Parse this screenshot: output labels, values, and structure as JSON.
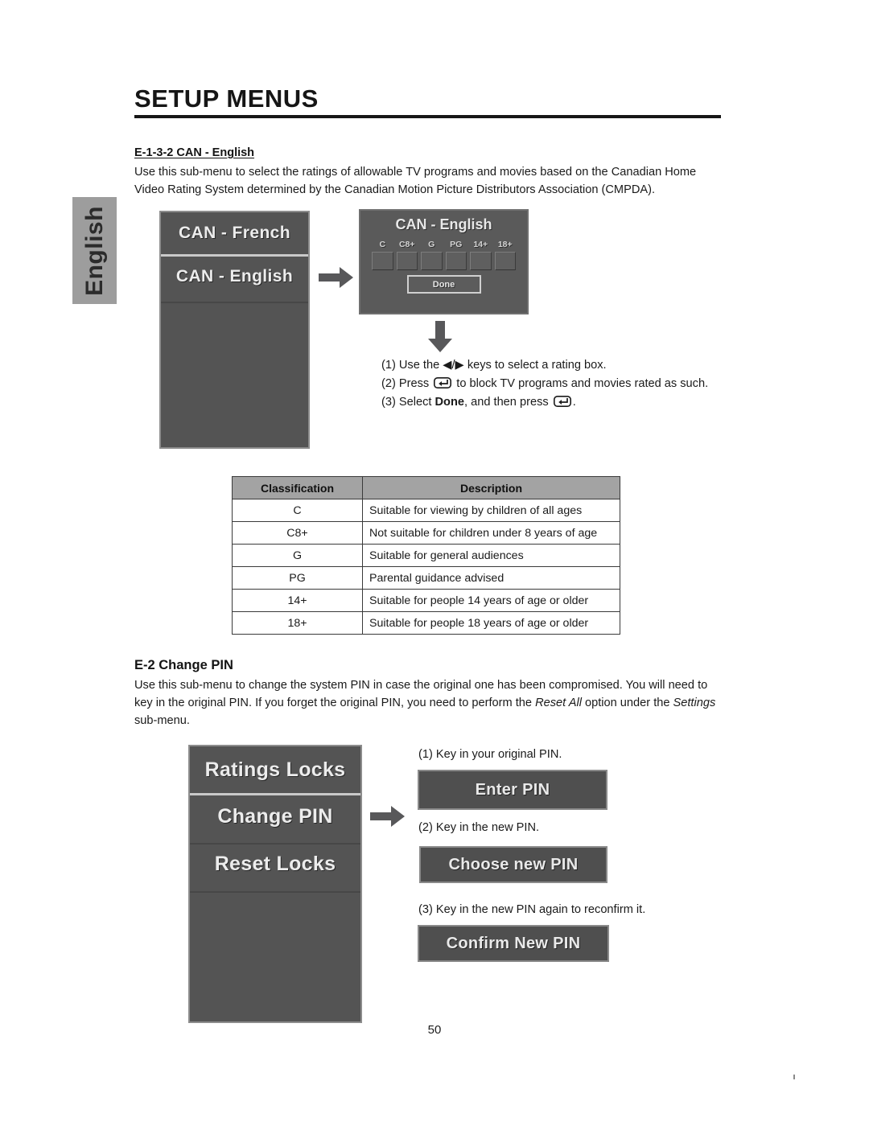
{
  "sidebar": {
    "language_tab": "English"
  },
  "header": {
    "title": "SETUP MENUS"
  },
  "sections": {
    "can_english": {
      "heading": "E-1-3-2 CAN - English",
      "paragraph": "Use this sub-menu to select the ratings of allowable TV programs and movies based on the Canadian Home Video Rating System determined by the Canadian Motion Picture Distributors Association (CMPDA)."
    },
    "change_pin": {
      "heading": "E-2  Change PIN",
      "paragraph_part1": "Use this sub-menu to change the system PIN in case the original one has been compromised. You will need to key in the original PIN. If you forget the original PIN, you need to perform the ",
      "paragraph_italic1": "Reset All",
      "paragraph_part2": " option under the ",
      "paragraph_italic2": "Settings",
      "paragraph_part3": " sub-menu."
    }
  },
  "osd": {
    "language_menu": {
      "items": [
        {
          "label": "CAN - French"
        },
        {
          "label": "CAN - English"
        }
      ]
    },
    "can_english_panel": {
      "title": "CAN - English",
      "ratings": [
        "C",
        "C8+",
        "G",
        "PG",
        "14+",
        "18+"
      ],
      "done_label": "Done"
    },
    "locks_menu": {
      "items": [
        {
          "label": "Ratings Locks"
        },
        {
          "label": "Change PIN"
        },
        {
          "label": "Reset Locks"
        }
      ]
    },
    "pin_bars": [
      {
        "label": "Enter PIN"
      },
      {
        "label": "Choose new PIN"
      },
      {
        "label": "Confirm New PIN"
      }
    ]
  },
  "instructions": {
    "ratings": {
      "line1_prefix": "(1) Use the ",
      "line1_keys": "◀/▶",
      "line1_suffix": " keys to select a rating box.",
      "line2_prefix": "(2) Press ",
      "line2_suffix": " to block TV programs and movies rated as such.",
      "line3_prefix": "(3) Select ",
      "line3_bold": "Done",
      "line3_mid": ", and then press ",
      "line3_suffix": "."
    },
    "pin": [
      "(1) Key in your original PIN.",
      "(2) Key in the new PIN.",
      "(3) Key in the new PIN again to reconfirm it."
    ]
  },
  "table": {
    "headers": [
      "Classification",
      "Description"
    ],
    "rows": [
      {
        "classification": "C",
        "description": "Suitable for viewing by children of all ages"
      },
      {
        "classification": "C8+",
        "description": "Not suitable for children under 8 years of age"
      },
      {
        "classification": "G",
        "description": "Suitable for general audiences"
      },
      {
        "classification": "PG",
        "description": "Parental guidance advised"
      },
      {
        "classification": "14+",
        "description": "Suitable for people 14 years of age or older"
      },
      {
        "classification": "18+",
        "description": "Suitable for people 18 years of age or older"
      }
    ]
  },
  "footer": {
    "page_number": "50"
  },
  "colors": {
    "tab_bg": "#9d9d9d",
    "osd_bg": "#545454",
    "osd_border": "#8d8d8d",
    "table_header_bg": "#a3a3a3",
    "arrow": "#58585a",
    "text": "#1a1a1a"
  }
}
